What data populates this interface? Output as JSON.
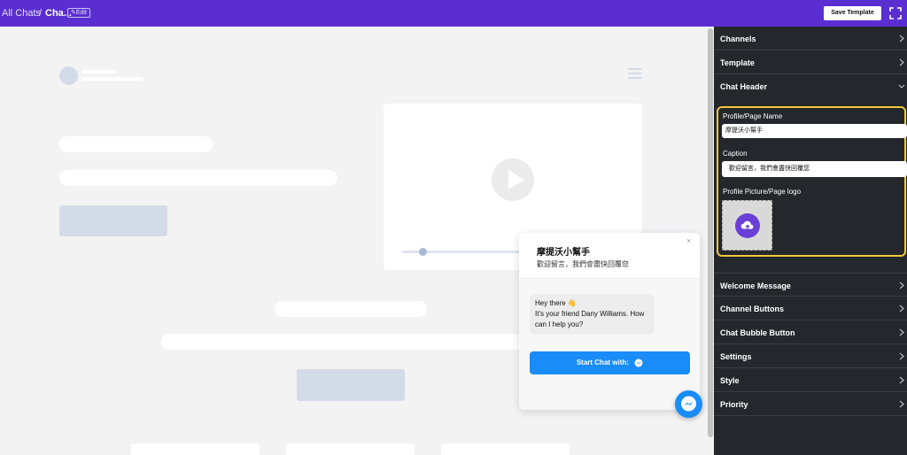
{
  "topbar": {
    "breadcrumb_all": "All Chats",
    "breadcrumb_sep": "/",
    "breadcrumb_current": "Cha...",
    "edit_label": "Edit",
    "save_label": "Save Template",
    "bg_color": "#5a2ed1"
  },
  "chat_popup": {
    "title": "摩提沃小幫手",
    "caption": "歡迎留言，我們會盡快回覆您",
    "close_symbol": "×",
    "greeting_line1": "Hey there 👋",
    "greeting_line2": "It's your friend Dany Williams. How can I help you?",
    "start_button": "Start Chat with:",
    "accent_color": "#1a8cf7"
  },
  "sidebar": {
    "sections_top": [
      {
        "label": "Channels",
        "chevron": "right"
      },
      {
        "label": "Template",
        "chevron": "right"
      },
      {
        "label": "Chat Header",
        "chevron": "down"
      }
    ],
    "chat_header": {
      "name_label": "Profile/Page Name",
      "name_value": "摩提沃小幫手",
      "caption_label": "Caption",
      "caption_value": "歡迎留言，我們會盡快回覆您",
      "logo_label": "Profile Picture/Page logo",
      "highlight_color": "#f0c93a"
    },
    "sections_bottom": [
      {
        "label": "Welcome Message",
        "chevron": "right"
      },
      {
        "label": "Channel Buttons",
        "chevron": "right"
      },
      {
        "label": "Chat Bubble Button",
        "chevron": "right"
      },
      {
        "label": "Settings",
        "chevron": "right"
      },
      {
        "label": "Style",
        "chevron": "right"
      },
      {
        "label": "Priority",
        "chevron": "right"
      }
    ]
  }
}
